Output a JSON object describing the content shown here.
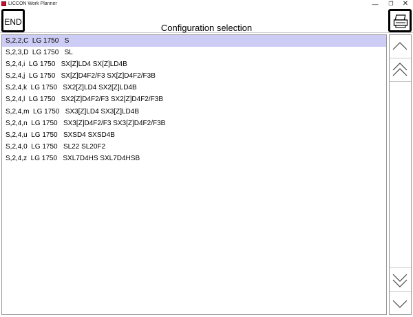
{
  "window": {
    "title": "LICCON Work Planner",
    "controls": {
      "minimize": "—",
      "maximize": "❐",
      "close": "✕"
    }
  },
  "toolbar": {
    "end_label": "END",
    "title": "Configuration selection",
    "print_icon": "printer-icon"
  },
  "configurations": [
    {
      "label": "S,2,2,C  LG 1750   S",
      "selected": true
    },
    {
      "label": "S,2,3,D  LG 1750   SL",
      "selected": false
    },
    {
      "label": "S,2,4,i  LG 1750   SX[Z]LD4 SX[Z]LD4B",
      "selected": false
    },
    {
      "label": "S,2,4,j  LG 1750   SX[Z]D4F2/F3 SX[Z]D4F2/F3B",
      "selected": false
    },
    {
      "label": "S,2,4,k  LG 1750   SX2[Z]LD4 SX2[Z]LD4B",
      "selected": false
    },
    {
      "label": "S,2,4,l  LG 1750   SX2[Z]D4F2/F3 SX2[Z]D4F2/F3B",
      "selected": false
    },
    {
      "label": "S,2,4,m  LG 1750   SX3[Z]LD4 SX3[Z]LD4B",
      "selected": false
    },
    {
      "label": "S,2,4,n  LG 1750   SX3[Z]D4F2/F3 SX3[Z]D4F2/F3B",
      "selected": false
    },
    {
      "label": "S,2,4,u  LG 1750   SXSD4 SXSD4B",
      "selected": false
    },
    {
      "label": "S,2,4,0  LG 1750   SL22 SL20F2",
      "selected": false
    },
    {
      "label": "S,2,4,z  LG 1750   SXL7D4HS SXL7D4HSB",
      "selected": false
    }
  ],
  "scrollbar": {
    "icons": [
      "scroll-up-icon",
      "page-up-icon",
      "page-down-icon",
      "scroll-down-icon"
    ]
  },
  "colors": {
    "selection": "#ccccf5",
    "border": "#000000"
  }
}
